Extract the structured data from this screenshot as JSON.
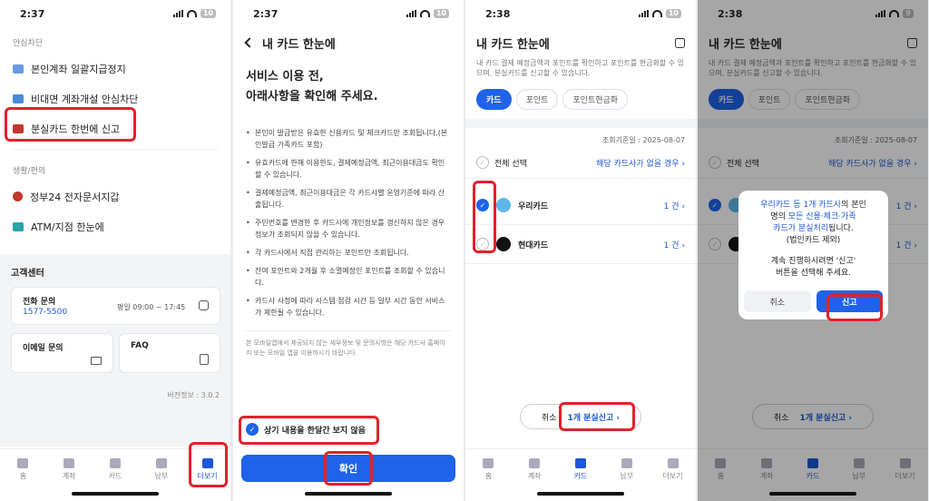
{
  "colors": {
    "accent": "#1e63e9",
    "highlight": "#e4202a"
  },
  "p1": {
    "time": "2:37",
    "battery": "10",
    "sec_safety": "안심차단",
    "items": [
      {
        "label": "본인계좌 일괄지급정지",
        "icon": "bank-icon"
      },
      {
        "label": "비대면 계좌개설 안심차단",
        "icon": "bank-icon"
      },
      {
        "label": "분실카드 한번에 신고",
        "icon": "card-icon"
      }
    ],
    "sec_life": "생활/편의",
    "life_items": [
      {
        "label": "정부24 전자문서지갑",
        "icon": "flag-icon"
      },
      {
        "label": "ATM/지점 한눈에",
        "icon": "atm-icon"
      }
    ],
    "cs_title": "고객센터",
    "phone_title": "전화 문의",
    "phone_number": "1577-5500",
    "phone_hours": "평일 09:00 ~ 17:45",
    "email_title": "이메일 문의",
    "faq_title": "FAQ",
    "version": "버전정보 : 3.0.2",
    "tabs": [
      "홈",
      "계좌",
      "카드",
      "납부",
      "더보기"
    ]
  },
  "p2": {
    "time": "2:37",
    "battery": "10",
    "title": "내 카드 한눈에",
    "heading1": "서비스 이용 전,",
    "heading2": "아래사항을 확인해 주세요.",
    "bullets": [
      "본인이 발급받은 유효한 신용카드 및 체크카드만 조회됩니다.(본인발급 가족카드 포함)",
      "유효카드에 한해 이용한도, 결제예정금액, 최근이용대금도 확인할 수 있습니다.",
      "결제예정금액, 최근이용대금은 각 카드사별 운영기준에 따라 산출됩니다.",
      "주민번호를 변경한 후 카드사에 개인정보를 갱신하지 않은 경우 정보가 조회되지 않을 수 있습니다.",
      "각 카드사에서 직접 관리하는 포인트만 조회됩니다.",
      "잔여 포인트와 2개월 후 소멸예정인 포인트를 조회할 수 있습니다.",
      "카드사 사정에 따라 시스템 점검 시간 등 일부 시간 동안 서비스가 제한될 수 있습니다."
    ],
    "fine": "본 모바일앱에서 제공되지 않는 세부정보 및 문의사항은 해당 카드사 홈페이지 또는 모바일 앱을 이용하시기 바랍니다.",
    "checkbox_label": "상기 내용을 한달간 보지 않음",
    "confirm": "확인"
  },
  "p3": {
    "time": "2:38",
    "battery": "10",
    "title": "내 카드 한눈에",
    "desc": "내 카드 결제 예정금액과 포인트를 확인하고 포인트를 현금화할 수 있으며, 분실카드를 신고할 수 있습니다.",
    "chips": [
      "카드",
      "포인트",
      "포인트현금화"
    ],
    "date": "조회기준일 : 2025-08-07",
    "select_all": "전체 선택",
    "no_card": "해당 카드사가 없을 경우",
    "cards": [
      {
        "name": "우리카드",
        "count": "1 건",
        "checked": true
      },
      {
        "name": "현대카드",
        "count": "1 건",
        "checked": false
      }
    ],
    "cancel": "취소",
    "report": "1개 분실신고"
  },
  "p4": {
    "time": "2:38",
    "battery": "9",
    "dialog_line1a": "우리카드 등 1개 카드사",
    "dialog_line1b": "의 본인",
    "dialog_line2a": "명의 ",
    "dialog_line2b": "모든 신용·체크·가족",
    "dialog_line3a": "카드가 분실처리",
    "dialog_line3b": "됩니다.",
    "dialog_line4": "(법인카드 제외)",
    "dialog_line5": "계속 진행하시려면 '신고'",
    "dialog_line6": "버튼을 선택해 주세요.",
    "cancel": "취소",
    "report": "신고"
  }
}
